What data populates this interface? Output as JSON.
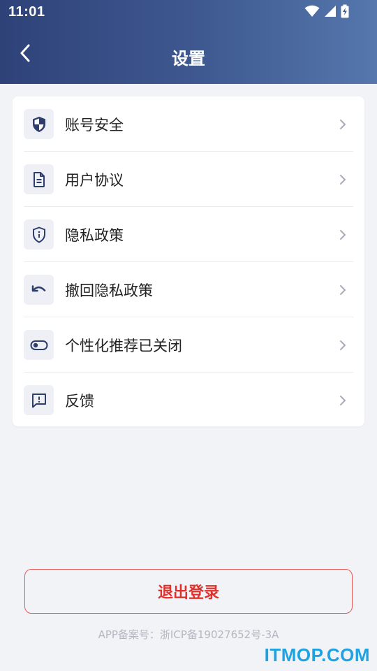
{
  "status_bar": {
    "time": "11:01",
    "icons": [
      "wifi-icon",
      "cellular-signal-icon",
      "battery-charging-icon"
    ]
  },
  "header": {
    "title": "设置",
    "back_icon": "back-arrow-icon",
    "gradient_colors": [
      "#2e4278",
      "#5577ad"
    ]
  },
  "settings_list": {
    "items": [
      {
        "label": "账号安全",
        "icon": "shield-icon"
      },
      {
        "label": "用户协议",
        "icon": "document-icon"
      },
      {
        "label": "隐私政策",
        "icon": "privacy-shield-icon"
      },
      {
        "label": "撤回隐私政策",
        "icon": "undo-icon"
      },
      {
        "label": "个性化推荐已关闭",
        "icon": "toggle-icon"
      },
      {
        "label": "反馈",
        "icon": "feedback-icon"
      }
    ]
  },
  "logout": {
    "label": "退出登录",
    "color": "#e0322d"
  },
  "footer": {
    "icp": "APP备案号：浙ICP备19027652号-3A",
    "watermark": "ITMOP.COM"
  }
}
